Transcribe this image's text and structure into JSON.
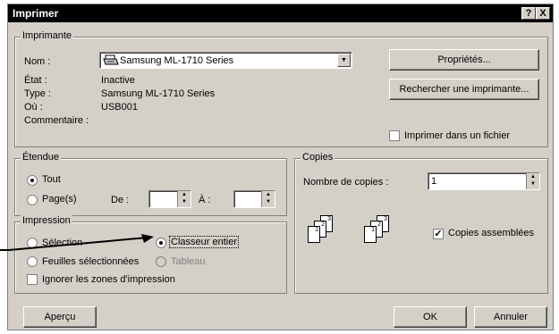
{
  "window": {
    "title": "Imprimer",
    "help_button": "?",
    "close_button": "X"
  },
  "printer_group": {
    "legend": "Imprimante",
    "name_label": "Nom :",
    "name_value": "Samsung ML-1710 Series",
    "state_label": "État :",
    "state_value": "Inactive",
    "type_label": "Type :",
    "type_value": "Samsung ML-1710 Series",
    "where_label": "Où :",
    "where_value": "USB001",
    "comment_label": "Commentaire :",
    "properties_button": "Propriétés...",
    "find_printer_button": "Rechercher une imprimante...",
    "print_to_file_label": "Imprimer dans un fichier",
    "print_to_file_checked": false
  },
  "range_group": {
    "legend": "Étendue",
    "all_label": "Tout",
    "pages_label": "Page(s)",
    "from_label": "De :",
    "to_label": "À :",
    "from_value": "",
    "to_value": "",
    "selected": "all"
  },
  "print_group": {
    "legend": "Impression",
    "selection_label": "Sélection",
    "entire_workbook_label": "Classeur entier",
    "active_sheets_label": "Feuilles sélectionnées",
    "table_label": "Tableau",
    "ignore_areas_label": "Ignorer les zones d'impression",
    "selected": "entire_workbook",
    "ignore_areas_checked": false
  },
  "copies_group": {
    "legend": "Copies",
    "count_label": "Nombre de copies :",
    "count_value": "1",
    "collate_label": "Copies assemblées",
    "collate_checked": true,
    "page_digits": [
      "1",
      "2",
      "3"
    ]
  },
  "footer": {
    "preview_button": "Aperçu",
    "ok_button": "OK",
    "cancel_button": "Annuler"
  },
  "icons": {
    "printer": "printer-icon",
    "dropdown": "chevron-down-icon",
    "spin_up": "spin-up-icon",
    "spin_down": "spin-down-icon"
  },
  "colors": {
    "titlebar": "#000000",
    "dialog_bg": "#d4d0c8",
    "arrow": "#000000"
  }
}
